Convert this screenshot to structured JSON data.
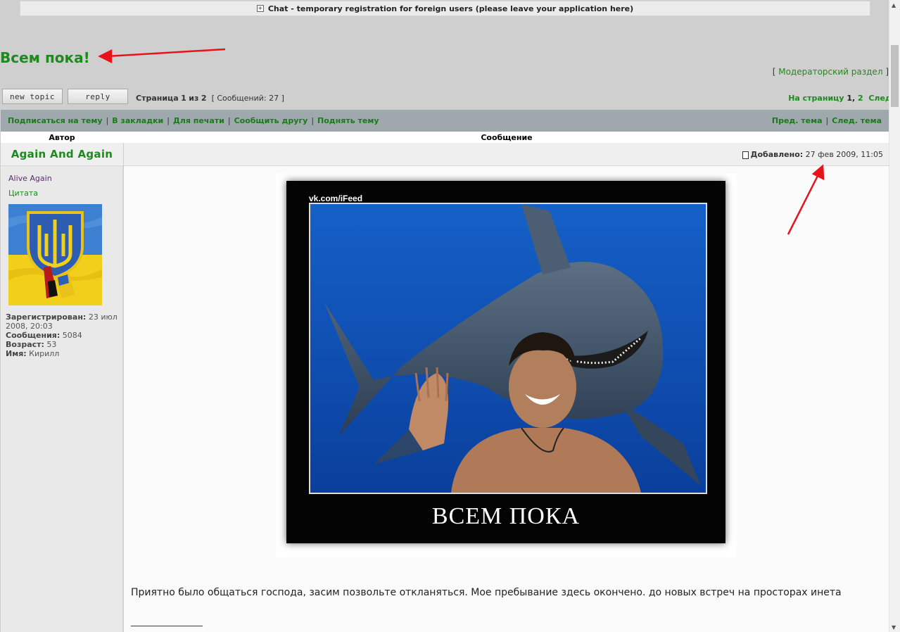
{
  "chat": {
    "label": "Chat - temporary registration for foreign users (please leave your application here)",
    "plus": "+"
  },
  "topic": {
    "title": "Всем пока!"
  },
  "moderator": {
    "open": "[ ",
    "label": "Модераторский раздел",
    "close": " ]"
  },
  "buttons": {
    "new_topic": "new topic",
    "reply": "reply"
  },
  "pagination": {
    "page_word": "Страница",
    "current": "1",
    "of_word": "из",
    "total": "2",
    "messages": "[ Сообщений: 27 ]",
    "goto_label": "На страницу",
    "page1": "1",
    "comma": ",",
    "page2": "2",
    "next": "След."
  },
  "actions": {
    "subscribe": "Подписаться на тему",
    "bookmarks": "В закладки",
    "print": "Для печати",
    "tell_friend": "Сообщить другу",
    "bump": "Поднять тему",
    "prev_topic": "Пред. тема",
    "next_topic": "След. тема",
    "sep": "|"
  },
  "table": {
    "author_header": "Автор",
    "message_header": "Сообщение"
  },
  "post": {
    "author": "Again And Again",
    "added_label": "Добавлено:",
    "date": "27 фев 2009, 11:05",
    "rank": "Alive Again",
    "quote": "Цитата",
    "profile": {
      "registered_label": "Зарегистрирован:",
      "registered_value": "23 июл 2008, 20:03",
      "messages_label": "Сообщения:",
      "messages_value": "5084",
      "age_label": "Возраст:",
      "age_value": "53",
      "name_label": "Имя:",
      "name_value": "Кирилл"
    },
    "image": {
      "watermark": "vk.com/iFeed",
      "caption": "ВСЕМ ПОКА"
    },
    "text": "Приятно было общаться господа, засим позвольте откланяться. Мое пребывание здесь окончено. до новых встреч на просторах инета",
    "signature_line": "_________________"
  },
  "colors": {
    "link_green": "#1e8a1e",
    "action_bar": "#9fa9ad",
    "arrow_red": "#e8131a"
  },
  "icons": {
    "scroll_up": "▲",
    "scroll_down": "▼"
  }
}
